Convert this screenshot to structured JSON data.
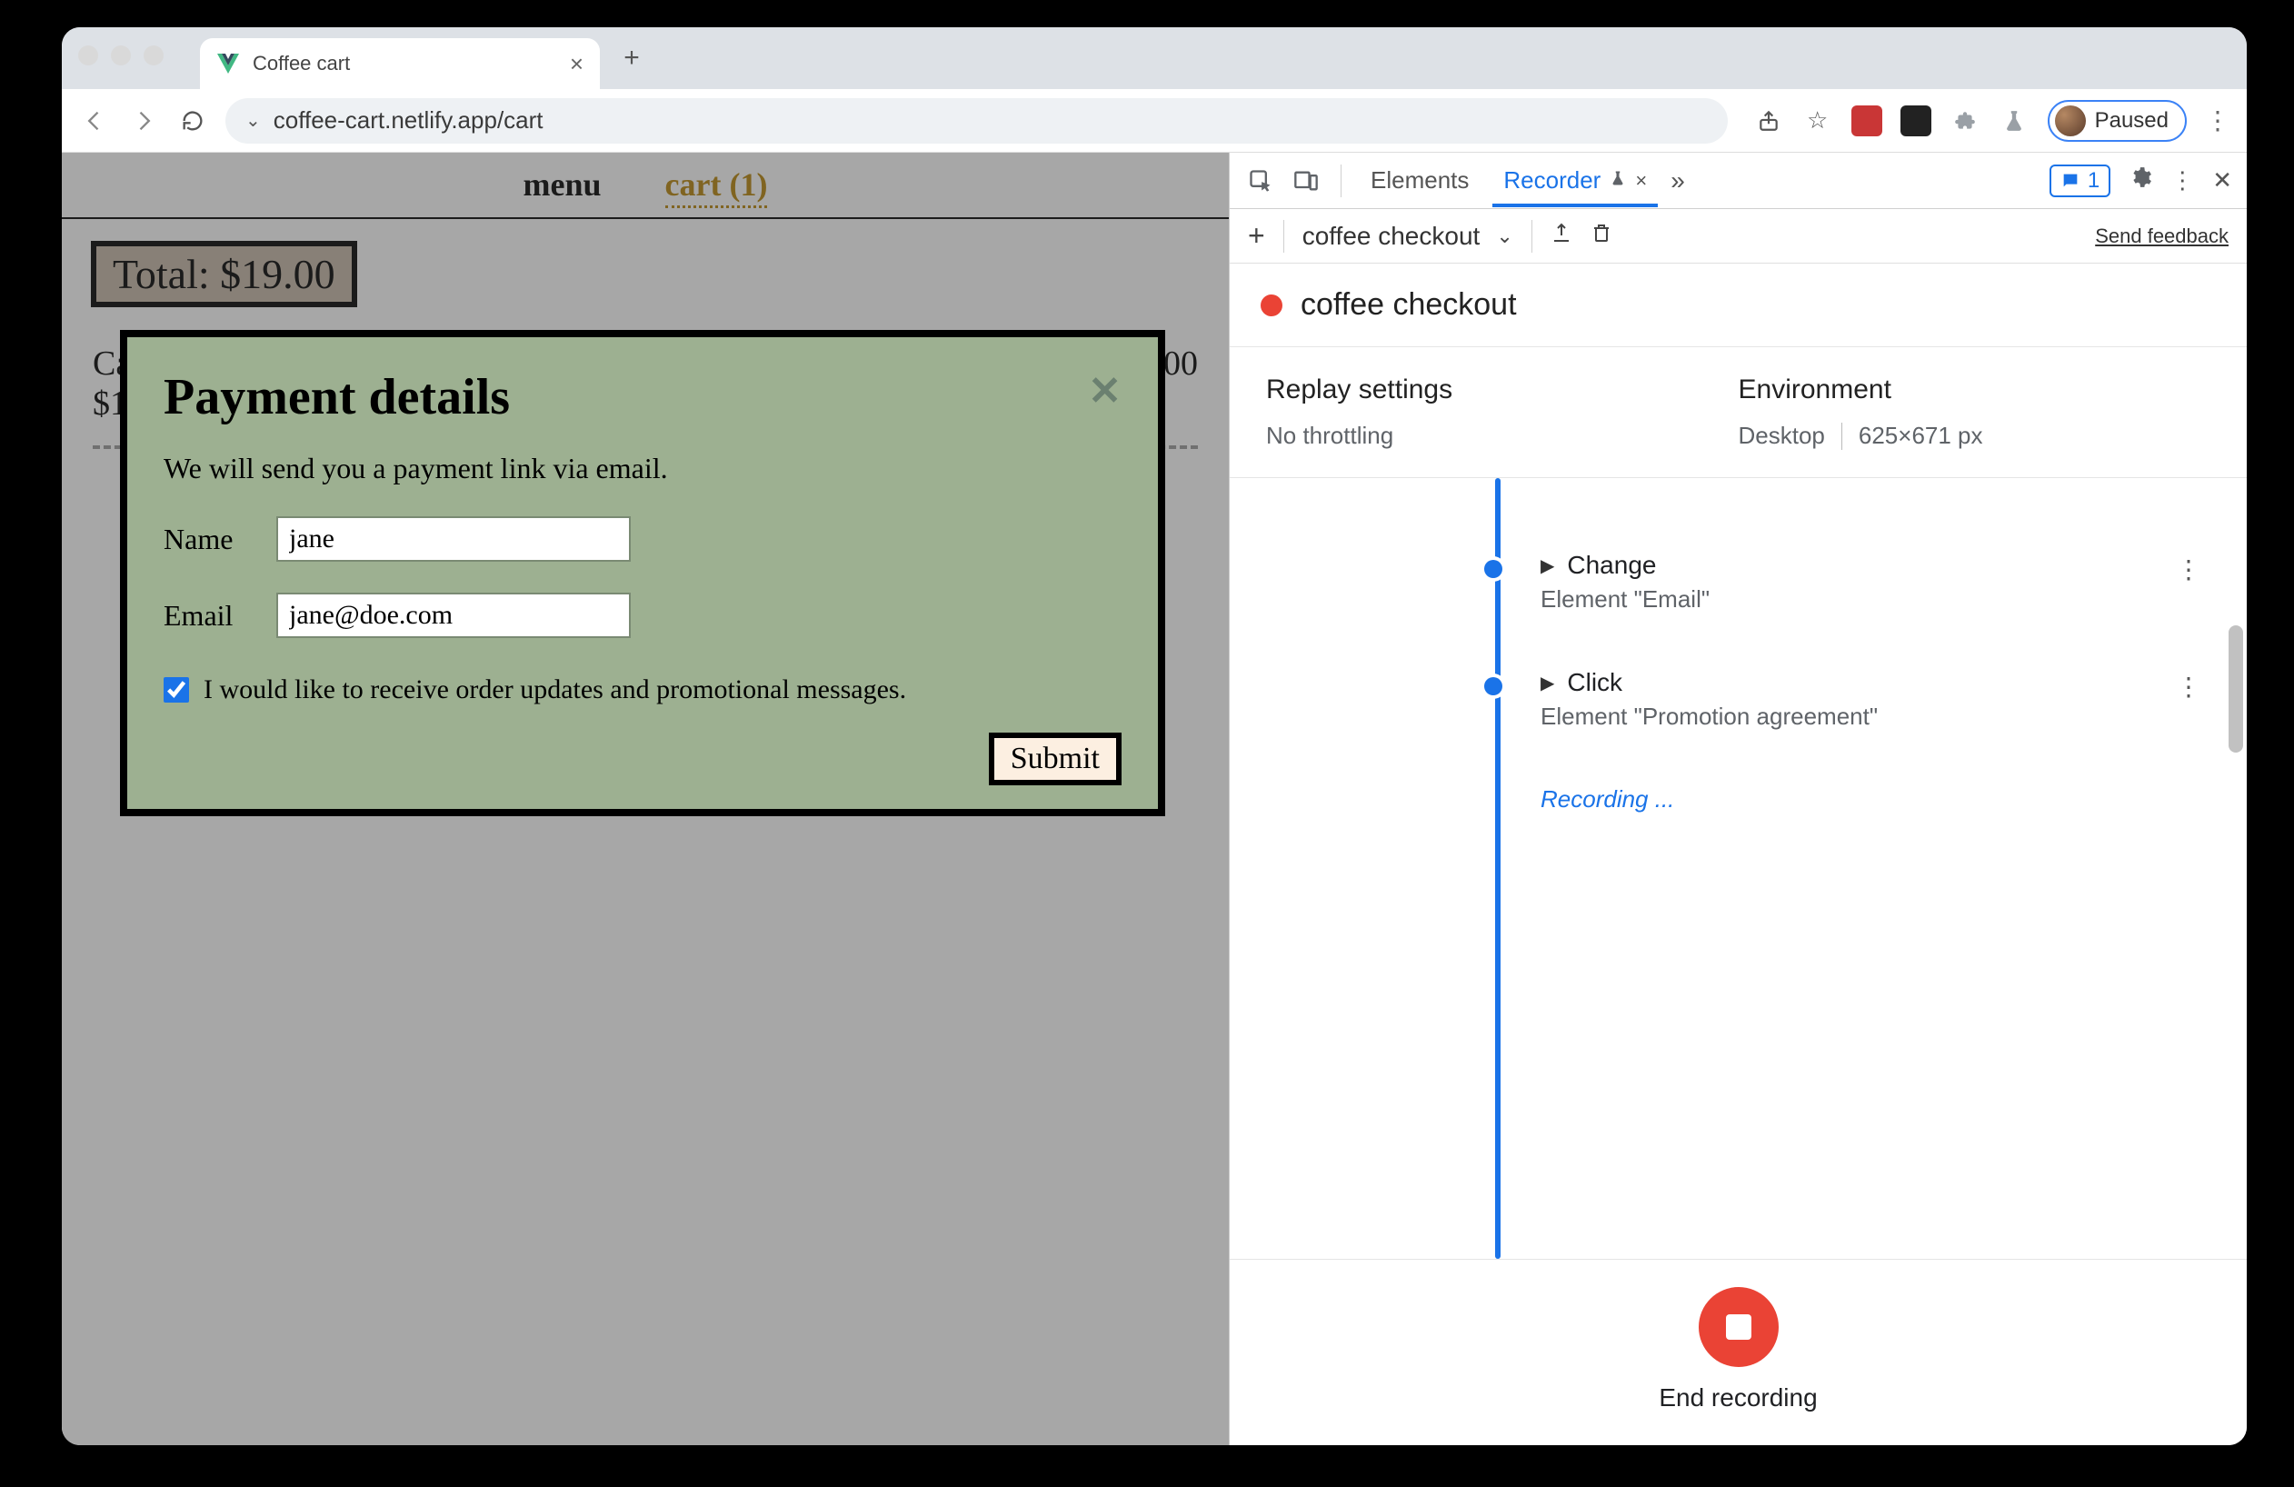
{
  "browser": {
    "tab_title": "Coffee cart",
    "url": "coffee-cart.netlify.app/cart",
    "paused_label": "Paused"
  },
  "page": {
    "nav": {
      "menu": "menu",
      "cart": "cart (1)"
    },
    "total_label": "Total: $19.00",
    "line_item_name": "Ca",
    "line_item_price": "$1",
    "line_total": "00"
  },
  "modal": {
    "title": "Payment details",
    "desc": "We will send you a payment link via email.",
    "name_label": "Name",
    "name_value": "jane",
    "email_label": "Email",
    "email_value": "jane@doe.com",
    "promo_label": "I would like to receive order updates and promotional messages.",
    "submit": "Submit"
  },
  "devtools": {
    "tabs": {
      "elements": "Elements",
      "recorder": "Recorder"
    },
    "msg_count": "1",
    "recorder_toolbar": {
      "name": "coffee checkout",
      "feedback": "Send feedback"
    },
    "title": "coffee checkout",
    "replay_settings": {
      "heading": "Replay settings",
      "throttling": "No throttling"
    },
    "environment": {
      "heading": "Environment",
      "device": "Desktop",
      "viewport": "625×671 px"
    },
    "steps": [
      {
        "action": "Change",
        "target": "Element \"Email\""
      },
      {
        "action": "Click",
        "target": "Element \"Promotion agreement\""
      }
    ],
    "recording_label": "Recording ...",
    "end_label": "End recording"
  }
}
